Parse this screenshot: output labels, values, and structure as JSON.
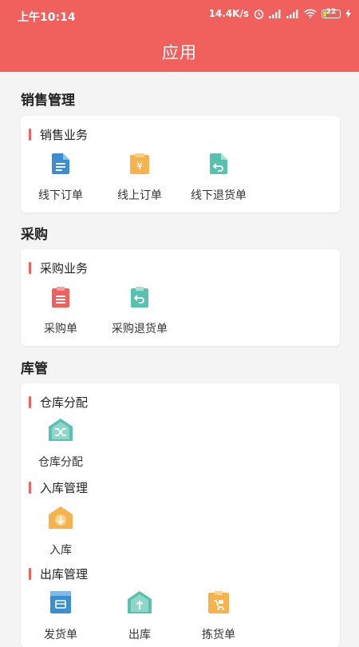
{
  "status_bar": {
    "time": "上午10:14",
    "net_speed": "14.4K/s",
    "battery": "22"
  },
  "header": {
    "title": "应用"
  },
  "sections": [
    {
      "title": "销售管理",
      "groups": [
        {
          "title": "销售业务",
          "items": [
            {
              "label": "线下订单",
              "icon": "document-icon",
              "color": "#3a8fd0"
            },
            {
              "label": "线上订单",
              "icon": "yen-clipboard-icon",
              "color": "#f6b24c"
            },
            {
              "label": "线下退货单",
              "icon": "return-document-icon",
              "color": "#59c2ae"
            }
          ]
        }
      ]
    },
    {
      "title": "采购",
      "groups": [
        {
          "title": "采购业务",
          "items": [
            {
              "label": "采购单",
              "icon": "list-clipboard-icon",
              "color": "#f0605c"
            },
            {
              "label": "采购退货单",
              "icon": "return-clipboard-icon",
              "color": "#59c2ae"
            }
          ]
        }
      ]
    },
    {
      "title": "库管",
      "groups": [
        {
          "title": "仓库分配",
          "items": [
            {
              "label": "仓库分配",
              "icon": "warehouse-shuffle-icon",
              "color": "#59c2ae"
            }
          ]
        },
        {
          "title": "入库管理",
          "items": [
            {
              "label": "入库",
              "icon": "warehouse-in-icon",
              "color": "#f6b24c"
            }
          ]
        },
        {
          "title": "出库管理",
          "items": [
            {
              "label": "发货单",
              "icon": "delivery-icon",
              "color": "#3a8fd0"
            },
            {
              "label": "出库",
              "icon": "warehouse-out-icon",
              "color": "#59c2ae"
            },
            {
              "label": "拣货单",
              "icon": "picking-icon",
              "color": "#f6b24c"
            }
          ]
        }
      ]
    }
  ]
}
